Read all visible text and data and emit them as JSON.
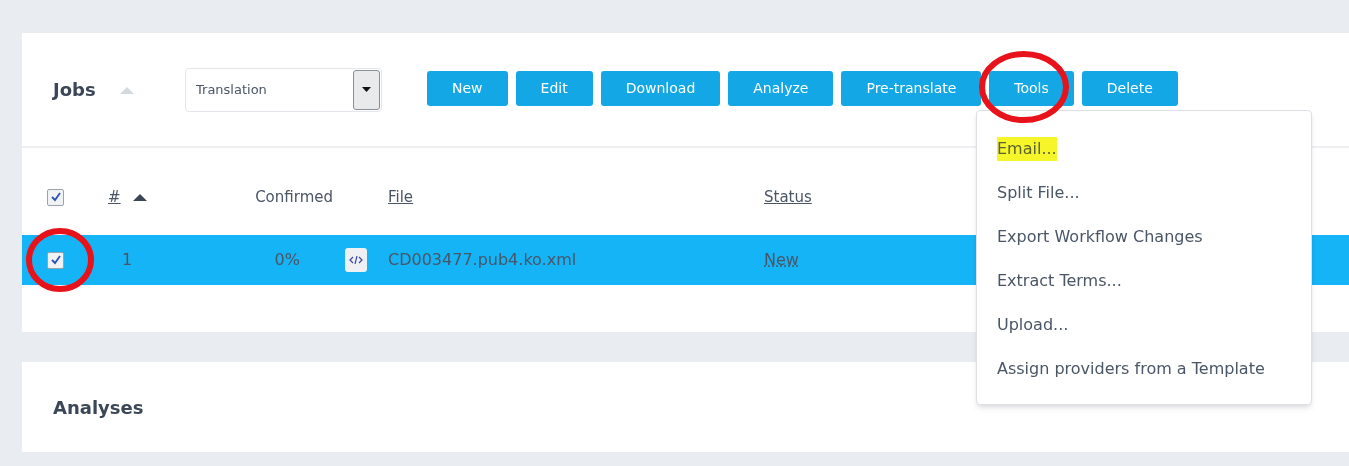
{
  "jobs": {
    "title": "Jobs",
    "filter": {
      "value": "Translation"
    },
    "toolbar": [
      {
        "label": "New"
      },
      {
        "label": "Edit"
      },
      {
        "label": "Download"
      },
      {
        "label": "Analyze"
      },
      {
        "label": "Pre-translate"
      },
      {
        "label": "Tools"
      },
      {
        "label": "Delete"
      }
    ],
    "select_all": {
      "checked": true
    },
    "columns": [
      {
        "label": "#",
        "sorted": true
      },
      {
        "label": "Confirmed",
        "sorted": false
      },
      {
        "label": "File",
        "sorted": false
      },
      {
        "label": "Status",
        "sorted": false
      }
    ],
    "rows": [
      {
        "checked": true,
        "selected": true,
        "number": "1",
        "confirmed": "0%",
        "file": "CD003477.pub4.ko.xml",
        "status": "New"
      }
    ]
  },
  "tools_menu": {
    "items": [
      {
        "label": "Email...",
        "highlighted": true
      },
      {
        "label": "Split File...",
        "highlighted": false
      },
      {
        "label": "Export Workflow Changes",
        "highlighted": false
      },
      {
        "label": "Extract Terms...",
        "highlighted": false
      },
      {
        "label": "Upload...",
        "highlighted": false
      },
      {
        "label": "Assign providers from a Template",
        "highlighted": false
      }
    ]
  },
  "analyses": {
    "title": "Analyses"
  }
}
